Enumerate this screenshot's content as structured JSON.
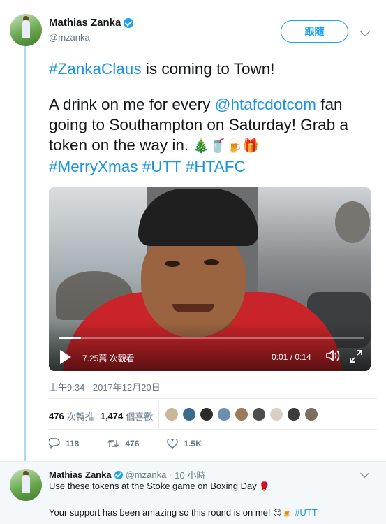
{
  "tweet": {
    "author": {
      "name": "Mathias Zanka",
      "handle": "@mzanka",
      "verified": true
    },
    "follow_label": "跟隨",
    "lines": {
      "p1_tag": "#ZankaClaus",
      "p1_rest": " is coming to Town!",
      "p2_a": "A drink on me for every ",
      "p2_mention": "@htafcdotcom",
      "p2_b": " fan going to Southampton on Saturday! Grab a token on the way in. ",
      "p2_emojis": [
        "🎄",
        "🥤",
        "🍺",
        "🎁"
      ],
      "hashtags": [
        "#MerryXmas",
        "#UTT",
        "#HTAFC"
      ]
    },
    "video": {
      "views": "7.25萬 次觀看",
      "time": "0:01 / 0:14",
      "progress": 0.07
    },
    "timestamp": "上午9:34 - 2017年12月20日",
    "stats": {
      "retweets_count": "476",
      "retweets_label": "次轉推",
      "likes_count": "1,474",
      "likes_label": "個喜歡"
    },
    "actions": {
      "replies": "118",
      "retweets": "476",
      "likes": "1.5K"
    }
  },
  "reply": {
    "name": "Mathias Zanka",
    "handle": "@mzanka",
    "time": "· 10 小時",
    "line1_text": "Use these tokens at the Stoke game on Boxing Day ",
    "line1_emoji": "🥊",
    "line2_text": "Your support has been amazing so this round is on me! ",
    "line2_emojis": "😏🍺",
    "line2_tag": "#UTT"
  },
  "colors": {
    "accent": "#1da1f2",
    "link": "#1b95e0",
    "muted": "#657786",
    "thread_line": "#a9dcf5"
  },
  "liker_colors": [
    "#c9b79a",
    "#3a6a8c",
    "#2b2b2b",
    "#6a8fb3",
    "#9b7a5a",
    "#4d4d4d",
    "#d9d0c4",
    "#3c3c3c",
    "#7a6f5f"
  ],
  "icons": [
    "verified-badge-icon",
    "chevron-down-icon",
    "play-icon",
    "volume-icon",
    "fullscreen-icon",
    "reply-icon",
    "retweet-icon",
    "like-icon"
  ]
}
